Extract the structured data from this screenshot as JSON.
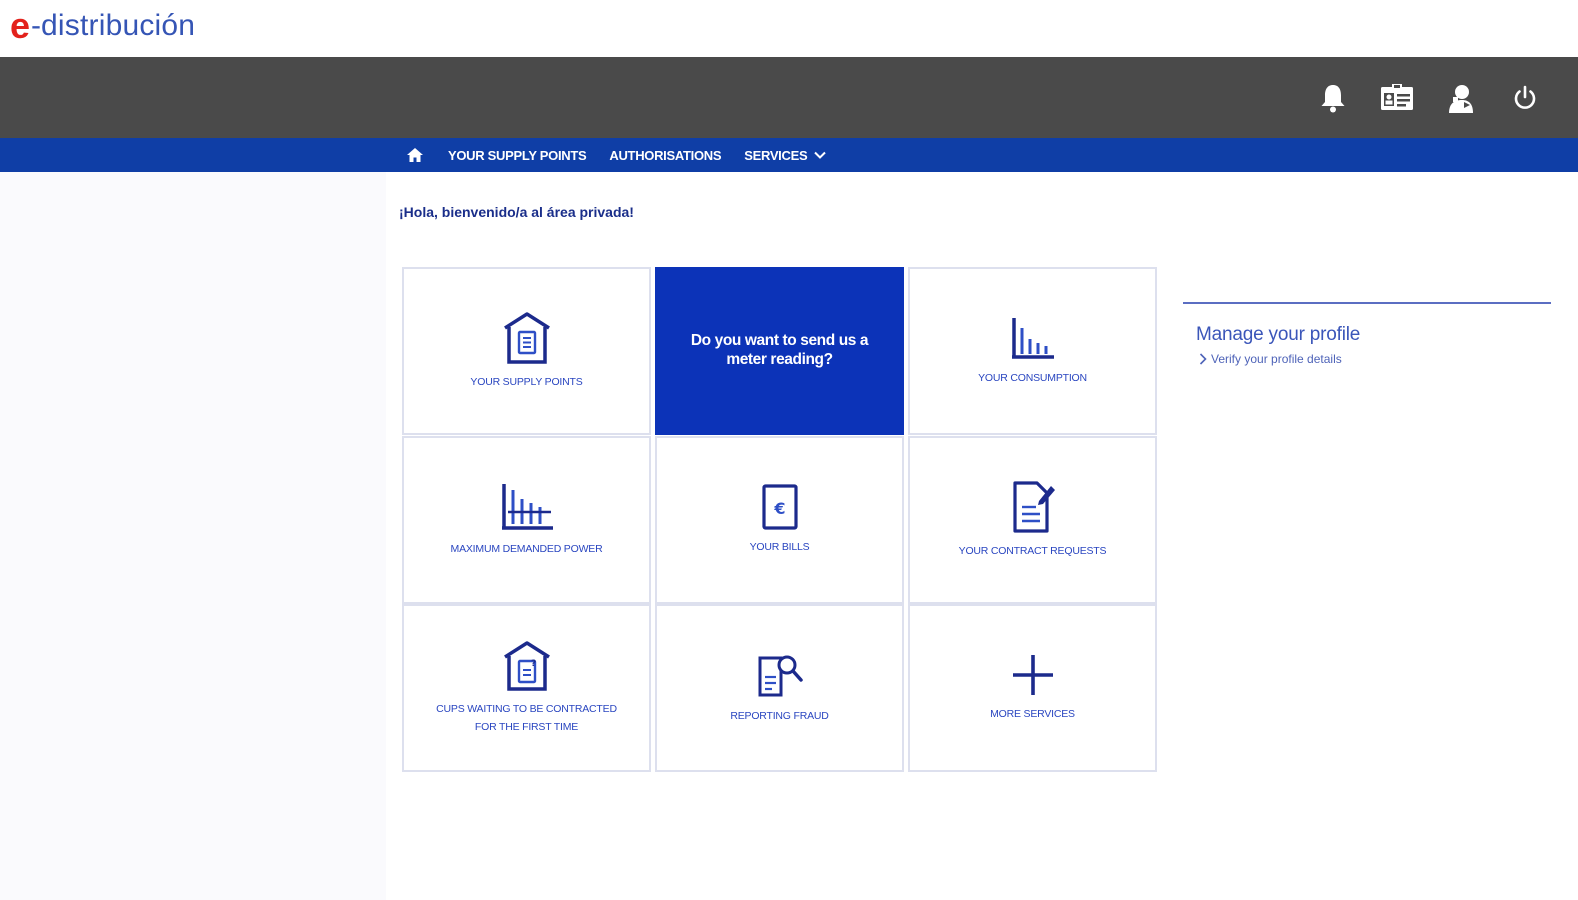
{
  "brand": {
    "e": "e",
    "dash": "-",
    "name": "distribución",
    "e_color": "#e3221c",
    "name_color": "#3555b5"
  },
  "topbar": {
    "icons": [
      "bell-icon",
      "id-card-icon",
      "user-support-icon",
      "power-icon"
    ]
  },
  "nav": {
    "home_icon": "home-icon",
    "items": [
      {
        "label": "YOUR SUPPLY POINTS"
      },
      {
        "label": "AUTHORISATIONS"
      },
      {
        "label": "SERVICES"
      }
    ]
  },
  "main": {
    "greeting": "¡Hola, bienvenido/a al área privada!",
    "tiles": [
      {
        "label": "YOUR SUPPLY POINTS",
        "icon": "house-document-icon"
      },
      {
        "label": "Do you want to send us a meter reading?",
        "featured": true
      },
      {
        "label": "YOUR CONSUMPTION",
        "icon": "bar-chart-icon"
      },
      {
        "label": "MAXIMUM DEMANDED POWER",
        "icon": "power-chart-icon"
      },
      {
        "label": "YOUR BILLS",
        "icon": "bill-euro-icon"
      },
      {
        "label": "YOUR CONTRACT REQUESTS",
        "icon": "contract-edit-icon"
      },
      {
        "label": "CUPS WAITING TO BE CONTRACTED FOR THE FIRST TIME",
        "icon": "house-question-icon"
      },
      {
        "label": "REPORTING FRAUD",
        "icon": "document-search-icon"
      },
      {
        "label": "MORE SERVICES",
        "icon": "plus-icon"
      }
    ]
  },
  "profile": {
    "title": "Manage your profile",
    "link": "Verify your profile details"
  },
  "colors": {
    "topbar": "#4a4a4a",
    "nav": "#0f3ea6",
    "accent": "#0c33b8",
    "tile_text": "#2a46c0"
  }
}
